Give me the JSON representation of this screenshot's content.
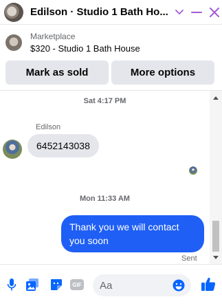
{
  "header": {
    "title": "Edilson · Studio 1 Bath Ho..."
  },
  "listing": {
    "kicker": "Marketplace",
    "title": "$320 - Studio 1 Bath House"
  },
  "actions": {
    "mark_sold": "Mark as sold",
    "more_options": "More options"
  },
  "chat": {
    "timestamp_1": "Sat 4:17 PM",
    "sender_name": "Edilson",
    "incoming_message": "6452143038",
    "timestamp_2": "Mon 11:33 AM",
    "outgoing_message": "Thank you we will contact you soon",
    "status": "Sent"
  },
  "composer": {
    "placeholder": "Aa",
    "gif_label": "GIF"
  },
  "colors": {
    "accent": "#0866ff",
    "outgoing_bubble": "#1f5ff5",
    "header_icons": "#a35bd6"
  }
}
